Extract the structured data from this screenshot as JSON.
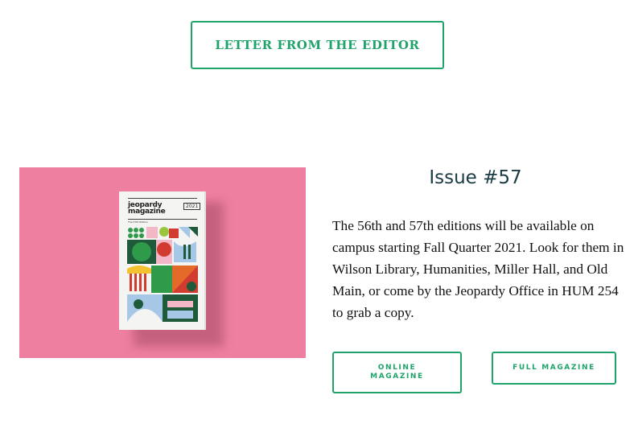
{
  "editor_button": {
    "label": "LETTER FROM THE EDITOR"
  },
  "cover": {
    "book_title": "jeopardy magazine",
    "book_year": "2021",
    "book_edition": "The 57th Edition"
  },
  "issue": {
    "title": "Issue #57",
    "description": "The 56th and 57th editions will be available on campus starting Fall Quarter 2021. Look for them in Wilson Library, Humanities, Miller Hall, and Old Main, or come by the Jeopardy Office in HUM 254 to grab a copy."
  },
  "buttons": {
    "online_label": "ONLINE MAGAZINE",
    "full_label": "FULL MAGAZINE"
  },
  "colors": {
    "accent": "#1fa36b",
    "cover_background": "#ef7fa0",
    "heading": "#1b3b45"
  }
}
